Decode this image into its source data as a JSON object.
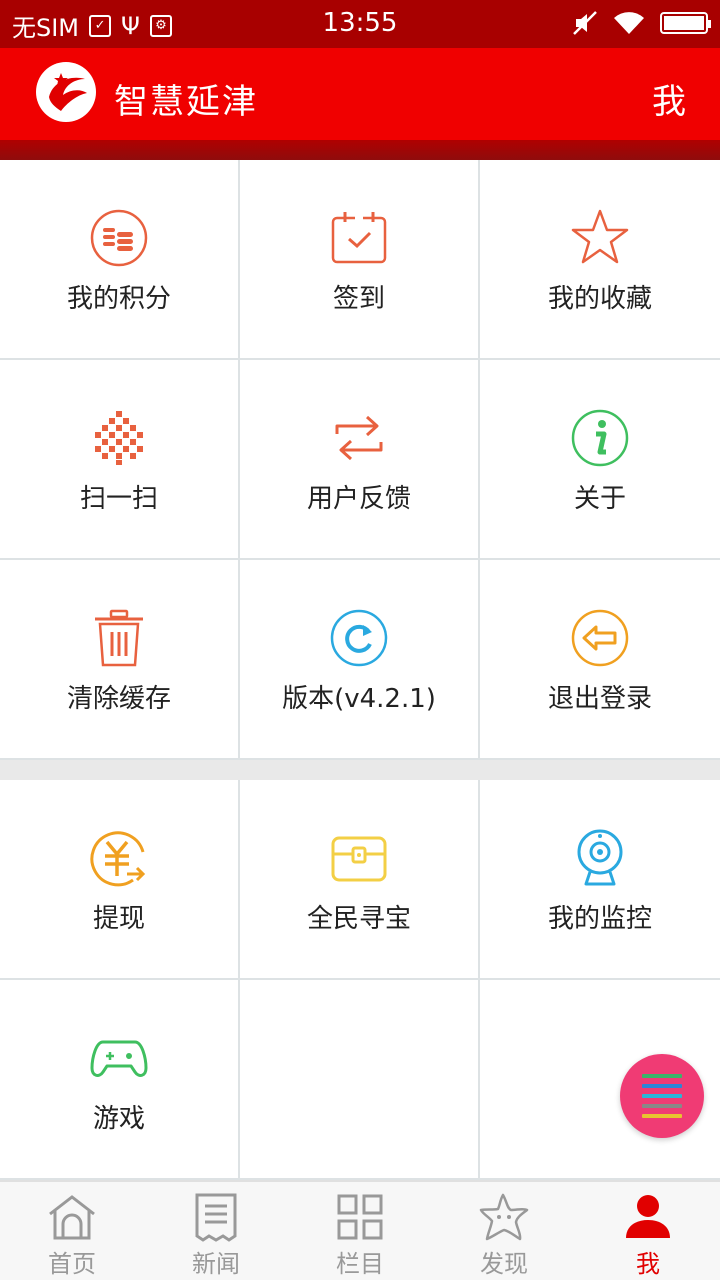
{
  "status_bar": {
    "carrier": "无SIM",
    "time": "13:55"
  },
  "app_bar": {
    "title": "智慧延津",
    "right_label": "我"
  },
  "grid_primary": [
    {
      "label": "我的积分",
      "icon": "coins-icon",
      "color": "#e8613f"
    },
    {
      "label": "签到",
      "icon": "calendar-check-icon",
      "color": "#e8613f"
    },
    {
      "label": "我的收藏",
      "icon": "star-icon",
      "color": "#e8613f"
    },
    {
      "label": "扫一扫",
      "icon": "qr-code-icon",
      "color": "#e8613f"
    },
    {
      "label": "用户反馈",
      "icon": "feedback-arrows-icon",
      "color": "#e8613f"
    },
    {
      "label": "关于",
      "icon": "info-icon",
      "color": "#3fbf5f"
    },
    {
      "label": "清除缓存",
      "icon": "trash-icon",
      "color": "#e8613f"
    },
    {
      "label": "版本(v4.2.1)",
      "icon": "refresh-icon",
      "color": "#2aa9e0"
    },
    {
      "label": "退出登录",
      "icon": "logout-icon",
      "color": "#f0a020"
    }
  ],
  "grid_secondary": [
    {
      "label": "提现",
      "icon": "withdraw-yuan-icon",
      "color": "#f0a020"
    },
    {
      "label": "全民寻宝",
      "icon": "treasure-chest-icon",
      "color": "#f3cf45"
    },
    {
      "label": "我的监控",
      "icon": "webcam-icon",
      "color": "#2aa9e0"
    },
    {
      "label": "游戏",
      "icon": "gamepad-icon",
      "color": "#3fbf5f"
    },
    {
      "label": "",
      "icon": "",
      "color": ""
    },
    {
      "label": "",
      "icon": "",
      "color": ""
    }
  ],
  "fab": {
    "icon": "menu-icon",
    "bar_colors": [
      "#3bb36a",
      "#2c86d6",
      "#29b6d8",
      "#888888",
      "#e8c330"
    ]
  },
  "tab_bar": [
    {
      "label": "首页",
      "icon": "home-icon"
    },
    {
      "label": "新闻",
      "icon": "news-icon"
    },
    {
      "label": "栏目",
      "icon": "grid-icon"
    },
    {
      "label": "发现",
      "icon": "starfish-icon"
    },
    {
      "label": "我",
      "icon": "user-icon",
      "active": true
    }
  ],
  "colors": {
    "brand_red": "#f00000",
    "status_red": "#a80000",
    "tab_active": "#e10000"
  }
}
